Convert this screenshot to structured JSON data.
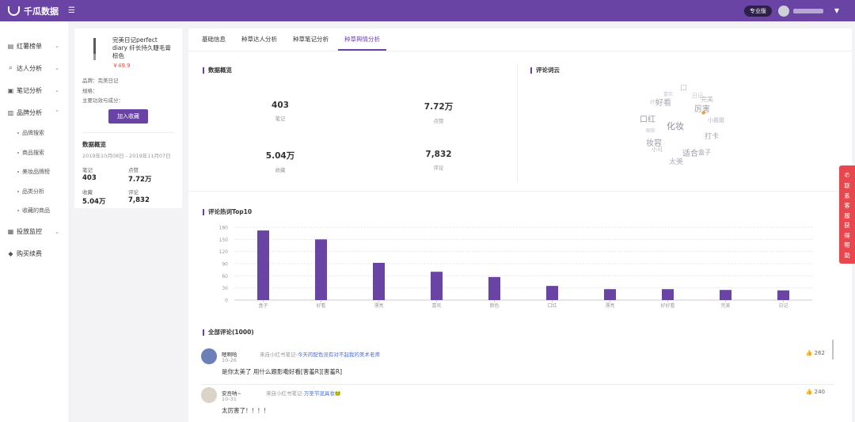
{
  "app": {
    "name": "千瓜数据",
    "edition": "专业版"
  },
  "sidebar": {
    "items": [
      {
        "label": "红薯榜单",
        "icon": "list-icon",
        "chevron": "⌄"
      },
      {
        "label": "达人分析",
        "icon": "search-icon",
        "chevron": "⌄"
      },
      {
        "label": "笔记分析",
        "icon": "note-icon",
        "chevron": "⌄"
      },
      {
        "label": "品牌分析",
        "icon": "brand-icon",
        "chevron": "⌃"
      }
    ],
    "subitems": [
      "品牌搜索",
      "商品搜索",
      "美妆品牌榜",
      "品类分析",
      "收藏的商品"
    ],
    "items2": [
      {
        "label": "投放监控",
        "icon": "monitor-icon",
        "chevron": "⌄"
      },
      {
        "label": "购买续费",
        "icon": "diamond-icon",
        "chevron": ""
      }
    ]
  },
  "product": {
    "name": "完美日记perfect diary 纤长持久睫毛膏 棕色",
    "price": "￥49.9",
    "brand": "品牌：完美日记",
    "spec": "规格：",
    "efficacy": "主要功效与成分：",
    "fav_button": "加入收藏",
    "overview_title": "数据概览",
    "overview_date": "2019年10月08日 - 2019年11月07日",
    "stats": [
      {
        "label": "笔记",
        "value": "403"
      },
      {
        "label": "点赞",
        "value": "7.72万"
      },
      {
        "label": "收藏",
        "value": "5.04万"
      },
      {
        "label": "评论",
        "value": "7,832"
      }
    ]
  },
  "tabs": [
    "基础信息",
    "种草达人分析",
    "种草笔记分析",
    "种草舆情分析"
  ],
  "active_tab": 3,
  "overview": {
    "title": "数据概览",
    "kpis": [
      {
        "value": "403",
        "label": "笔记"
      },
      {
        "value": "7.72万",
        "label": "点赞"
      },
      {
        "value": "5.04万",
        "label": "收藏"
      },
      {
        "value": "7,832",
        "label": "评论"
      }
    ]
  },
  "wordcloud": {
    "title": "评论词云",
    "words": [
      {
        "text": "口",
        "size": 9,
        "color": "#c5c5cf"
      },
      {
        "text": "日记",
        "size": 7,
        "color": "#c5c5cf"
      },
      {
        "text": "好看",
        "size": 10,
        "color": "#a8a8b4"
      },
      {
        "text": "好用",
        "size": 6,
        "color": "#c5c5cf"
      },
      {
        "text": "完美",
        "size": 8,
        "color": "#b8b8c4"
      },
      {
        "text": "喜欢",
        "size": 6,
        "color": "#c5c5cf"
      },
      {
        "text": "厉害",
        "size": 10,
        "color": "#9b9ba8"
      },
      {
        "text": "口红",
        "size": 10,
        "color": "#9b9ba8"
      },
      {
        "text": "小姐姐",
        "size": 7,
        "color": "#b0b0bc"
      },
      {
        "text": "化妆",
        "size": 11,
        "color": "#8e8e9c"
      },
      {
        "text": "眼影",
        "size": 6,
        "color": "#c5c5cf"
      },
      {
        "text": "打卡",
        "size": 9,
        "color": "#a0a0ad"
      },
      {
        "text": "妆容",
        "size": 10,
        "color": "#9b9ba8"
      },
      {
        "text": "小可",
        "size": 7,
        "color": "#b8b8c4"
      },
      {
        "text": "适合",
        "size": 10,
        "color": "#9b9ba8"
      },
      {
        "text": "盒子",
        "size": 8,
        "color": "#a8a8b4"
      },
      {
        "text": "太美",
        "size": 9,
        "color": "#b0b0bc"
      }
    ]
  },
  "chart_data": {
    "type": "bar",
    "title": "评论热词Top10",
    "categories": [
      "盒子",
      "好看",
      "漂亮",
      "喜欢",
      "颜色",
      "口红",
      "漂亮",
      "好好看",
      "完美",
      "日记"
    ],
    "values": [
      172,
      150,
      92,
      70,
      57,
      35,
      27,
      27,
      25,
      24
    ],
    "ylim": [
      0,
      180
    ],
    "yticks": [
      "0",
      "30",
      "60",
      "90",
      "120",
      "150",
      "180"
    ],
    "bar_color": "#6a44a4",
    "grid": true
  },
  "comments": {
    "title": "全部评论(1000)",
    "items": [
      {
        "user": "嗯啊哈",
        "source": "来自小红书笔记-",
        "link": "今天的配色没有对不起我的美术老师",
        "date": "10-26",
        "text": "是你太美了 用什么跟影嘞好看[害羞R][害羞R]",
        "likes": "262"
      },
      {
        "user": "安吾呐~",
        "source": "来自小红书笔记-",
        "link": "万圣节混具妆🐸",
        "date": "10-31",
        "text": "太厉害了！！！！",
        "likes": "240"
      }
    ]
  },
  "help": {
    "text": "联系客服获得帮助"
  }
}
